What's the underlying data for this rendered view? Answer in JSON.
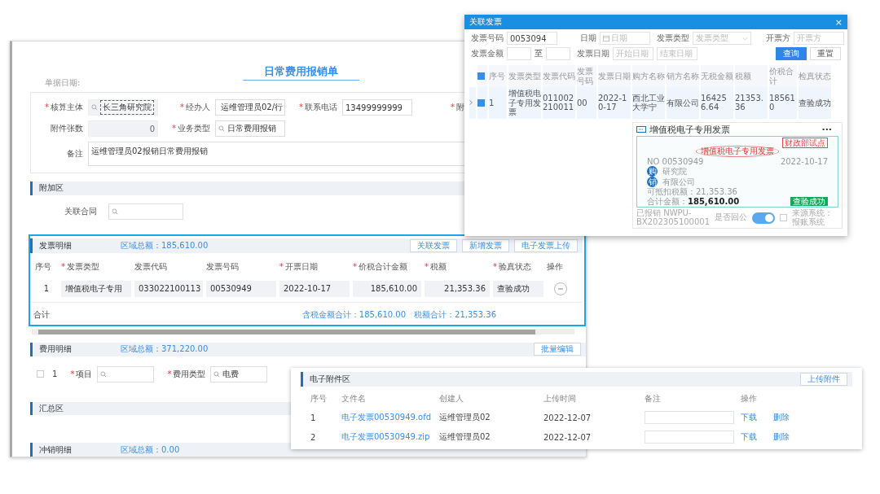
{
  "main_form": {
    "title": "日常费用报销单",
    "date_label": "单据日期:",
    "rows": [
      [
        {
          "mark": "*",
          "label": "核算主体",
          "kind": "search",
          "value": "长三角研究院",
          "disabled": true,
          "focused": true
        },
        {
          "mark": "*",
          "label": "经办人",
          "kind": "search",
          "value": "运维管理员02/行",
          "disabled": false
        },
        {
          "mark": "*",
          "label": "联系电话",
          "kind": "text",
          "value": "13499999999",
          "disabled": false
        },
        {
          "mark": "*",
          "label": "附",
          "kind": "cut"
        }
      ],
      [
        {
          "label": "附件张数",
          "kind": "number",
          "value": "0",
          "disabled": true
        },
        {
          "mark": "*",
          "label": "业务类型",
          "kind": "search",
          "value": "日常费用报销",
          "disabled": false
        }
      ]
    ],
    "remark": {
      "label": "备注",
      "value": "运维管理员02报销日常费用报销"
    }
  },
  "extra_section": {
    "title": "附加区",
    "fields": [
      {
        "label": "关联合同",
        "kind": "search"
      }
    ]
  },
  "invoice_section": {
    "title": "发票明细",
    "total": "区域总额：185,610.00",
    "highlighted": true,
    "buttons": [
      "关联发票",
      "新增发票",
      "电子发票上传"
    ],
    "columns": [
      {
        "label": "序号"
      },
      {
        "mark": "*",
        "label": "发票类型"
      },
      {
        "label": "发票代码"
      },
      {
        "label": "发票号码"
      },
      {
        "mark": "*",
        "label": "开票日期"
      },
      {
        "mark": "*",
        "label": "价税合计金额"
      },
      {
        "mark": "*",
        "label": "税额"
      },
      {
        "mark": "*",
        "label": "验真状态"
      },
      {
        "label": "操作"
      }
    ],
    "rows": [
      {
        "index": "1",
        "type": "增值税电子专用",
        "code": "033022100113",
        "number": "00530949",
        "date": "2022-10-17",
        "amount": "185,610.00",
        "tax": "21,353.36",
        "status": "查验成功"
      }
    ],
    "footer": {
      "label": "合计",
      "amount_total": "含税金额合计：185,610.00",
      "tax_total": "税额合计：21,353.36"
    }
  },
  "expense_section": {
    "title": "费用明细",
    "total": "区域总额：371,220.00",
    "button": "批量编辑",
    "rows": [
      {
        "checked": false,
        "index": "1",
        "fields": [
          {
            "mark": "*",
            "label": "项目"
          },
          {
            "mark": "*",
            "label": "费用类型",
            "value": "电费"
          }
        ]
      }
    ]
  },
  "summary_section": {
    "title": "汇总区"
  },
  "writeoff_section": {
    "title": "冲销明细",
    "total": "区域总额：0.00"
  },
  "modal": {
    "title": "关联发票",
    "close": "×",
    "filters": [
      {
        "label": "发票号码",
        "value": "0053094",
        "kind": "text"
      },
      {
        "label": "日期",
        "placeholder": "日期",
        "kind": "date"
      },
      {
        "label": "发票类型",
        "placeholder": "发票类型",
        "kind": "select"
      },
      {
        "label": "开票方",
        "placeholder": "开票方",
        "kind": "text"
      }
    ],
    "amount_filter": {
      "label": "发票金额",
      "separator": "至"
    },
    "date_filter": {
      "label": "发票日期",
      "from": "开始日期",
      "to": "结束日期"
    },
    "buttons": [
      {
        "label": "查询",
        "kind": "primary"
      },
      {
        "label": "重置",
        "kind": "default"
      }
    ],
    "select_all": true,
    "columns": [
      "序号",
      "发票类型",
      "发票代码",
      "发票号码",
      "发票日期",
      "购方名称",
      "销方名称",
      "无税金额",
      "税额",
      "价税合计",
      "检真状态"
    ],
    "rows": [
      {
        "checked": true,
        "cells": [
          "1",
          "增值税电子专用发票",
          "011002210011",
          "00",
          "2022-10-17",
          "西北工业大学宁",
          "有限公司",
          "164256.64",
          "21353.36",
          "185610",
          "查验成功"
        ]
      }
    ],
    "card": {
      "title": "增值税电子专用发票",
      "more": "···",
      "pilot": "财政部试点",
      "stamp": "增值税电子专用发票",
      "number": "NO 00530949",
      "date": "2022-10-17",
      "parties": [
        {
          "badge": "购",
          "name": "研究院"
        },
        {
          "badge": "销",
          "name": "有限公司"
        }
      ],
      "deductible": "可抵扣税额：21,353.36",
      "total_label": "合计金额：",
      "total": "185,610.00",
      "status": "查验成功",
      "reimbursed": "已报销 NWPU-BX202305100001",
      "toggle_label": "是否回公",
      "toggle_on": true,
      "source_checked": false,
      "source": "来源系统：报账系统"
    }
  },
  "attachments": {
    "title": "电子附件区",
    "button": "上传附件",
    "columns": [
      "序号",
      "文件名",
      "创建人",
      "上传时间",
      "备注",
      "操作"
    ],
    "rows": [
      {
        "index": "1",
        "file": "电子发票00530949.ofd",
        "creator": "运维管理员02",
        "time": "2022-12-07",
        "actions": [
          "下载",
          "删除"
        ]
      },
      {
        "index": "2",
        "file": "电子发票00530949.zip",
        "creator": "运维管理员02",
        "time": "2022-12-07",
        "actions": [
          "下载",
          "删除"
        ]
      }
    ]
  }
}
